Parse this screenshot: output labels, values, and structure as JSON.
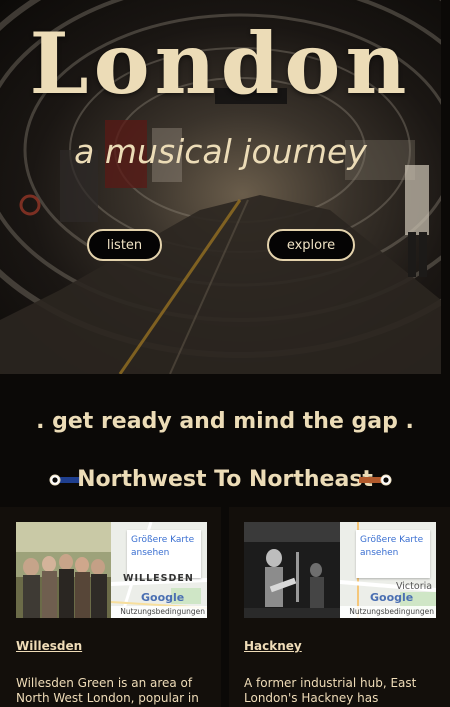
{
  "hero": {
    "title": "London",
    "subtitle": "a musical journey",
    "listen_label": "listen",
    "explore_label": "explore"
  },
  "tagline": ". get ready and mind the gap .",
  "line": {
    "title": "Northwest To Northeast",
    "left_color": "#1f3f8f",
    "right_color": "#b25a2c"
  },
  "cards": [
    {
      "link": "Willesden",
      "map_link": "Größere Karte ansehen",
      "map_place": "WILLESDEN",
      "map_brand": "Google",
      "map_terms": "Nutzungsbedingungen",
      "text": "Willesden Green is an area of North West London, popular in"
    },
    {
      "link": "Hackney",
      "map_link": "Größere Karte ansehen",
      "map_place": "Victoria",
      "map_brand": "Google",
      "map_terms": "Nutzungsbedingungen",
      "text": "A former industrial hub, East London's Hackney has"
    }
  ],
  "colors": {
    "accent": "#ecdcb7",
    "background": "#0b0907"
  }
}
